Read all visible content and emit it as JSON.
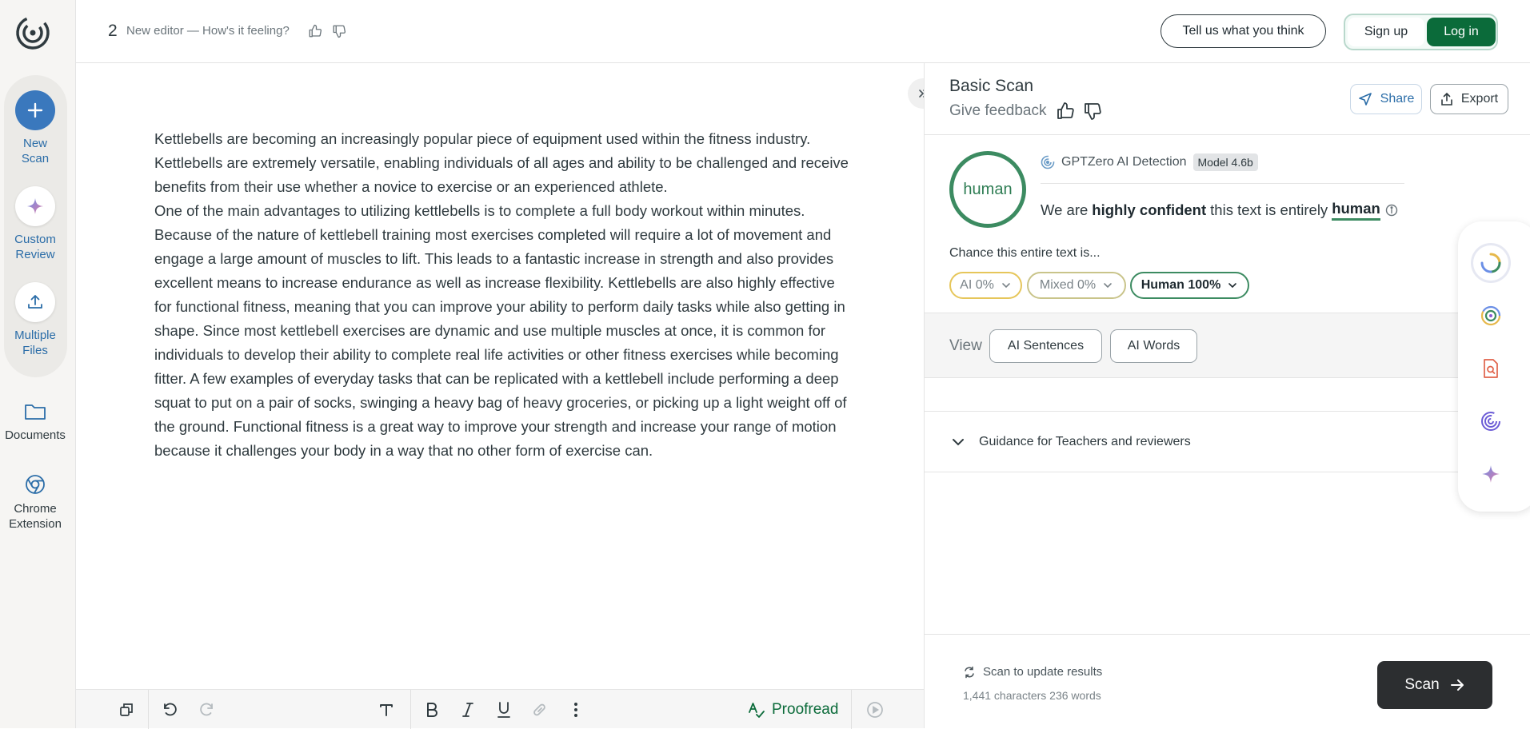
{
  "header": {
    "doc_number": "2",
    "doc_subtitle": "New editor — How's it feeling?",
    "feedback_button": "Tell us what you think",
    "signup": "Sign up",
    "login": "Log in"
  },
  "sidebar": {
    "items": [
      {
        "label_line1": "New",
        "label_line2": "Scan",
        "icon": "plus-icon"
      },
      {
        "label_line1": "Custom",
        "label_line2": "Review",
        "icon": "sparkle-icon"
      },
      {
        "label_line1": "Multiple",
        "label_line2": "Files",
        "icon": "upload-icon"
      },
      {
        "label_line1": "Documents",
        "icon": "folder-icon"
      },
      {
        "label_line1": "Chrome",
        "label_line2": "Extension",
        "icon": "chrome-icon"
      }
    ]
  },
  "editor": {
    "paragraphs": [
      "Kettlebells are becoming an increasingly popular piece of equipment used within the fitness industry. Kettlebells are extremely versatile, enabling individuals of all ages and ability to be challenged and receive benefits from their use whether a novice to exercise or an experienced athlete.",
      "One of the main advantages to utilizing kettlebells is to complete a full body workout within minutes. Because of the nature of kettlebell training most exercises completed will require a lot of movement and engage a large amount of muscles to lift. This leads to a fantastic increase in strength and also provides excellent means to increase endurance as well as increase flexibility. Kettlebells are also highly effective for functional fitness, meaning that you can improve your ability to perform daily tasks while also getting in shape. Since most kettlebell exercises are dynamic and use multiple muscles at once, it is common for individuals to develop their ability to complete real life activities or other fitness exercises while becoming fitter. A few examples of everyday tasks that can be replicated with a kettlebell include performing a deep squat to put on a pair of socks, swinging a heavy bag of heavy groceries, or picking up a light weight off of the ground. Functional fitness is a great way to improve your strength and increase your range of motion because it challenges your body in a way that no other form of exercise can."
    ],
    "proofread": "Proofread"
  },
  "panel": {
    "title": "Basic Scan",
    "give_feedback": "Give feedback",
    "share": "Share",
    "export": "Export",
    "ring_label": "human",
    "detector": "GPTZero AI Detection",
    "model": "Model 4.6b",
    "confidence_prefix": "We are",
    "confidence_strong": "highly confident",
    "confidence_mid": "this text is entirely",
    "confidence_result": "human",
    "chance_label": "Chance this entire text is...",
    "chips": [
      {
        "label": "AI 0%",
        "color": "#e6c65a"
      },
      {
        "label": "Mixed 0%",
        "color": "#c9c48a"
      },
      {
        "label": "Human 100%",
        "color": "#3c8b61"
      }
    ],
    "view_label": "View",
    "view_buttons": [
      "AI Sentences",
      "AI Words"
    ],
    "guidance": "Guidance for Teachers and reviewers",
    "scan_update": "Scan to update results",
    "counts": "1,441 characters 236 words",
    "scan_button": "Scan"
  },
  "colors": {
    "brand_green": "#0b6b3a",
    "human_green": "#3c8b61",
    "link_blue": "#2b6da8"
  }
}
